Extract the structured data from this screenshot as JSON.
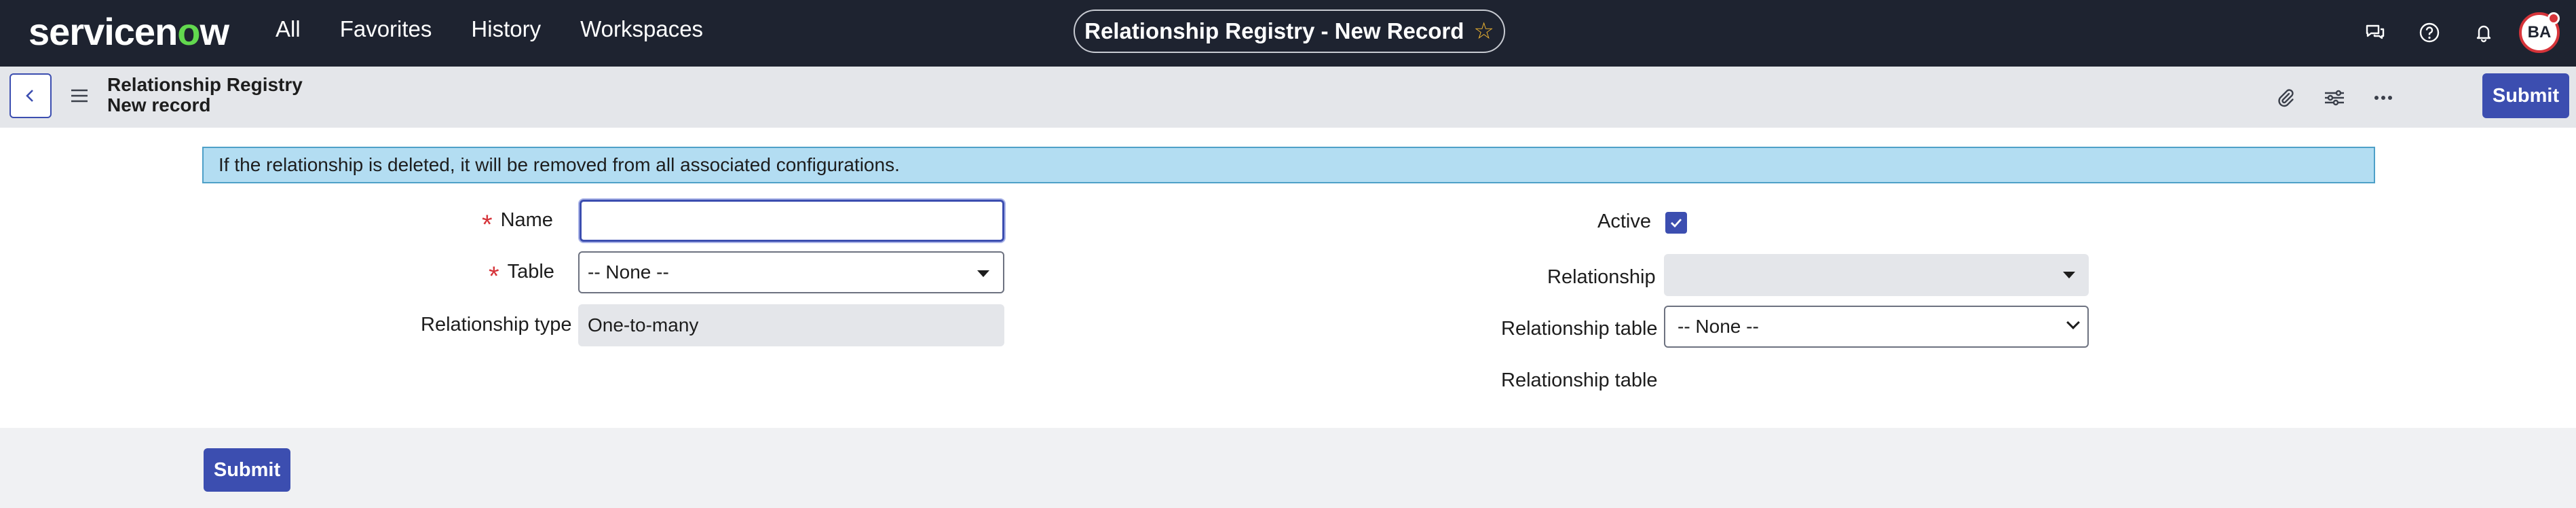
{
  "brand": {
    "logo_pre": "servicen",
    "logo_o": "o",
    "logo_post": "w",
    "accent": "#62d84e"
  },
  "nav": {
    "items": [
      "All",
      "Favorites",
      "History",
      "Workspaces"
    ]
  },
  "window_title": "Relationship Registry - New Record",
  "user": {
    "initials": "BA"
  },
  "icons": {
    "top": [
      "chat-icon",
      "help-icon",
      "bell-icon"
    ],
    "sub": [
      "attachment-icon",
      "settings-sliders-icon",
      "more-icon"
    ]
  },
  "subheader": {
    "line1": "Relationship Registry",
    "line2": "New record",
    "submit_label": "Submit"
  },
  "banner": "If the relationship is deleted, it will be removed from all associated configurations.",
  "form": {
    "name_label": "Name",
    "name_value": "",
    "table_label": "Table",
    "table_value": "-- None --",
    "relationship_type_label": "Relationship type",
    "relationship_type_value": "One-to-many",
    "active_label": "Active",
    "active_checked": true,
    "relationship_label": "Relationship",
    "relationship_value": "",
    "relationship_table_label": "Relationship table",
    "relationship_table_value": "-- None --",
    "relationship_table_label2": "Relationship table"
  },
  "footer": {
    "submit_label": "Submit"
  },
  "colors": {
    "primary": "#3c4eb0",
    "required": "#d6343a",
    "banner_bg": "#b3ddf2",
    "nav_bg": "#1e2330"
  }
}
